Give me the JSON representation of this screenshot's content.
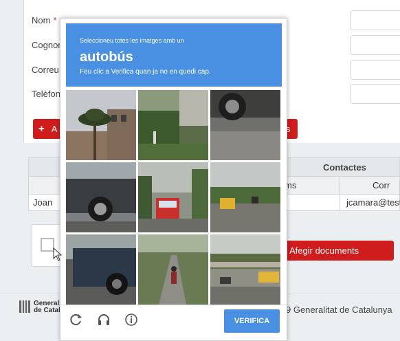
{
  "form": {
    "labels": {
      "nom": "Nom",
      "required_mark": "*",
      "cognoms": "Cognor",
      "correu": "Correu",
      "telefon": "Telèfon"
    },
    "add_button_label": "A",
    "add_button_icon": "plus-icon",
    "right_button_fragment": "s"
  },
  "table": {
    "group_header": "Contactes",
    "subheaders": [
      "ms",
      "Corr"
    ],
    "row": [
      "Joan",
      "jcamara@test"
    ]
  },
  "documents": {
    "button_label": "Afegir documents"
  },
  "captcha": {
    "instruction": "Seleccioneu totes les imatges amb un",
    "object": "autobús",
    "hint": "Feu clic a Verifica quan ja no en quedi cap.",
    "verify_label": "VERIFICA",
    "icons": [
      "reload-icon",
      "audio-icon",
      "info-icon"
    ],
    "tiles": [
      "palm-tree-building",
      "garden-hedge",
      "car-wheel-road",
      "dark-pickup-truck",
      "red-bus-street",
      "yellow-school-bus",
      "blue-car-road",
      "cyclist-road",
      "school-bus-overpass"
    ],
    "accent_color": "#4a90e2"
  },
  "footer": {
    "brand_line1": "Generali",
    "brand_line2": "de Catalu",
    "copyright": "9 Generalitat de Catalunya"
  }
}
